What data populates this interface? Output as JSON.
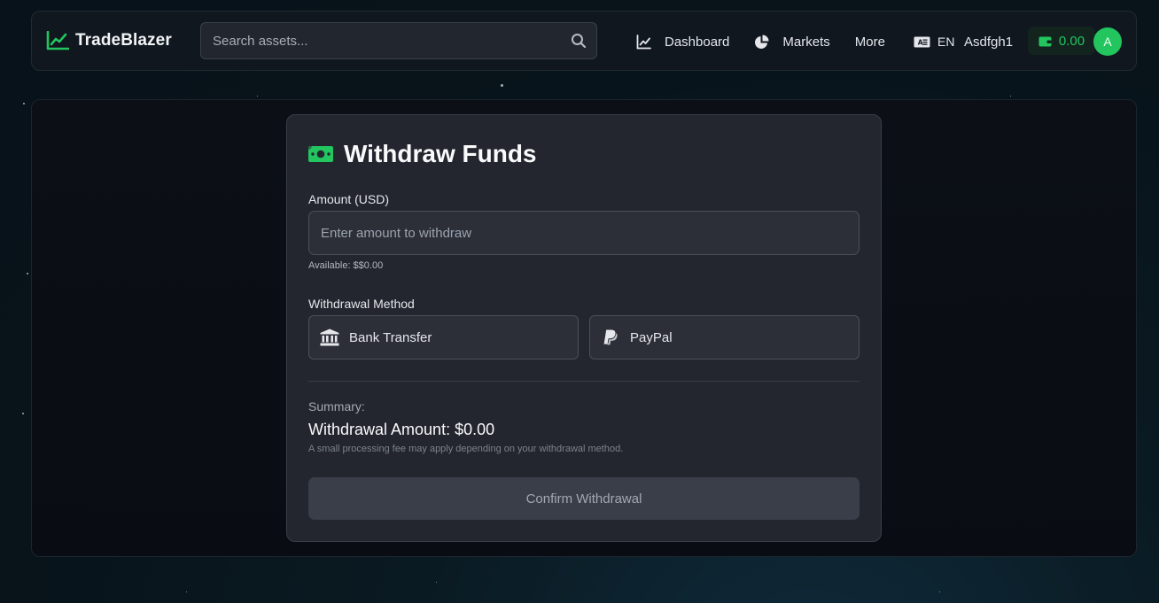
{
  "colors": {
    "accent": "#22c55e",
    "background": "#08131a",
    "card": "#23262f",
    "button_disabled": "#3a3e48"
  },
  "header": {
    "brand_name": "TradeBlazer",
    "brand_icon": "chart-line-icon",
    "search": {
      "placeholder": "Search assets...",
      "value": ""
    },
    "nav": [
      {
        "label": "Dashboard",
        "icon": "chart-line-icon"
      },
      {
        "label": "Markets",
        "icon": "pie-chart-icon"
      },
      {
        "label": "More"
      }
    ],
    "language": {
      "code": "EN",
      "icon": "language-icon"
    },
    "username": "Asdfgh1",
    "wallet": {
      "balance": "0.00",
      "icon": "wallet-icon"
    },
    "avatar_initial": "A"
  },
  "withdraw": {
    "title": "Withdraw Funds",
    "title_icon": "money-bill-icon",
    "amount_label": "Amount (USD)",
    "amount_placeholder": "Enter amount to withdraw",
    "amount_value": "",
    "available": "Available: $$0.00",
    "method_label": "Withdrawal Method",
    "methods": [
      {
        "label": "Bank Transfer",
        "icon": "bank-icon"
      },
      {
        "label": "PayPal",
        "icon": "paypal-icon"
      }
    ],
    "summary_label": "Summary:",
    "summary_amount": "Withdrawal Amount: $0.00",
    "fee_note": "A small processing fee may apply depending on your withdrawal method.",
    "confirm_label": "Confirm Withdrawal"
  }
}
